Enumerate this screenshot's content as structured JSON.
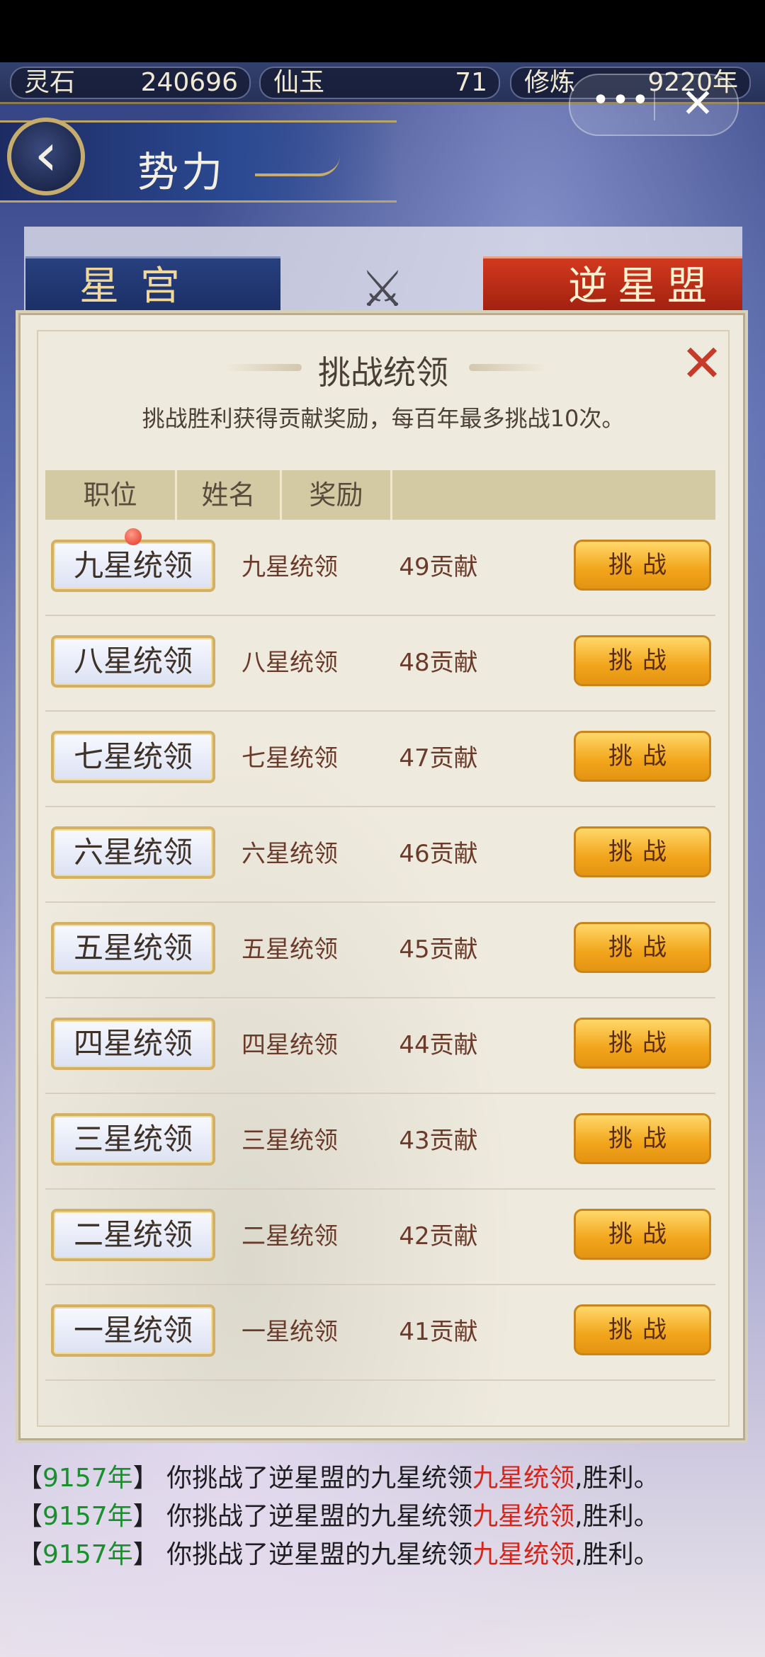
{
  "resources": [
    {
      "label": "灵石",
      "value": "240696"
    },
    {
      "label": "仙玉",
      "value": "71"
    },
    {
      "label": "修炼",
      "value": "9220年"
    }
  ],
  "capsule": {
    "more_icon": "•••",
    "close_icon": "✕"
  },
  "header": {
    "title": "势力",
    "back_icon": "‹"
  },
  "factions": {
    "left": "星宫",
    "vs_icon": "⚔",
    "right": "逆星盟"
  },
  "dialog": {
    "title": "挑战统领",
    "subtitle": "挑战胜利获得贡献奖励，每百年最多挑战10次。",
    "close_icon": "✕",
    "columns": [
      "职位",
      "姓名",
      "奖励",
      ""
    ],
    "button_label": "挑战",
    "rows": [
      {
        "rank": "九星统领",
        "name": "九星统领",
        "reward": "49贡献"
      },
      {
        "rank": "八星统领",
        "name": "八星统领",
        "reward": "48贡献"
      },
      {
        "rank": "七星统领",
        "name": "七星统领",
        "reward": "47贡献"
      },
      {
        "rank": "六星统领",
        "name": "六星统领",
        "reward": "46贡献"
      },
      {
        "rank": "五星统领",
        "name": "五星统领",
        "reward": "45贡献"
      },
      {
        "rank": "四星统领",
        "name": "四星统领",
        "reward": "44贡献"
      },
      {
        "rank": "三星统领",
        "name": "三星统领",
        "reward": "43贡献"
      },
      {
        "rank": "二星统领",
        "name": "二星统领",
        "reward": "42贡献"
      },
      {
        "rank": "一星统领",
        "name": "一星统领",
        "reward": "41贡献"
      }
    ]
  },
  "log": [
    {
      "year": "9157年",
      "text": "你挑战了逆星盟的九星统领",
      "target": "九星统领",
      "result": ",胜利。"
    },
    {
      "year": "9157年",
      "text": "你挑战了逆星盟的九星统领",
      "target": "九星统领",
      "result": ",胜利。"
    },
    {
      "year": "9157年",
      "text": "你挑战了逆星盟的九星统领",
      "target": "九星统领",
      "result": ",胜利。"
    }
  ]
}
